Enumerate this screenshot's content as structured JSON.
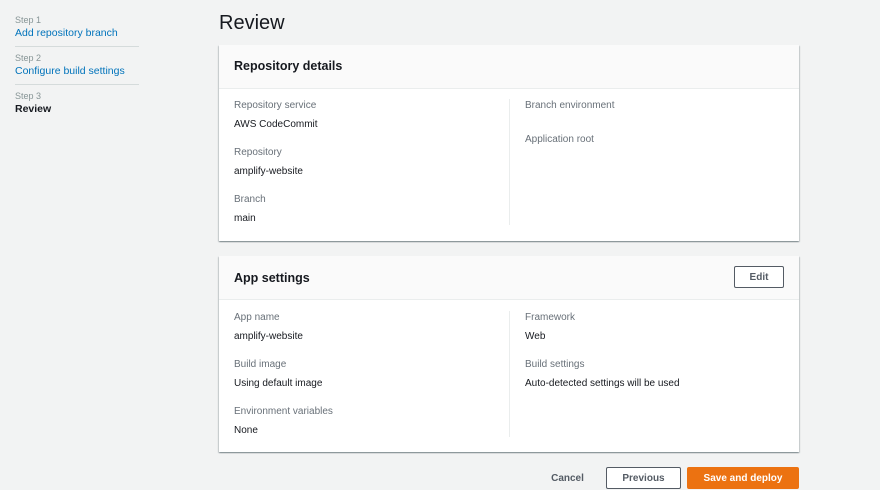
{
  "steps": [
    {
      "num": "Step 1",
      "label": "Add repository branch"
    },
    {
      "num": "Step 2",
      "label": "Configure build settings"
    },
    {
      "num": "Step 3",
      "label": "Review"
    }
  ],
  "page": {
    "title": "Review"
  },
  "repo_panel": {
    "title": "Repository details",
    "left": [
      {
        "key": "Repository service",
        "value": "AWS CodeCommit"
      },
      {
        "key": "Repository",
        "value": "amplify-website"
      },
      {
        "key": "Branch",
        "value": "main"
      }
    ],
    "right": [
      {
        "key": "Branch environment",
        "value": ""
      },
      {
        "key": "Application root",
        "value": ""
      }
    ]
  },
  "app_panel": {
    "title": "App settings",
    "edit_label": "Edit",
    "left": [
      {
        "key": "App name",
        "value": "amplify-website"
      },
      {
        "key": "Build image",
        "value": "Using default image"
      },
      {
        "key": "Environment variables",
        "value": "None"
      }
    ],
    "right": [
      {
        "key": "Framework",
        "value": "Web"
      },
      {
        "key": "Build settings",
        "value": "Auto-detected settings will be used"
      }
    ]
  },
  "footer": {
    "cancel_label": "Cancel",
    "previous_label": "Previous",
    "deploy_label": "Save and deploy"
  },
  "colors": {
    "accent": "#ec7211",
    "link": "#0073bb"
  }
}
